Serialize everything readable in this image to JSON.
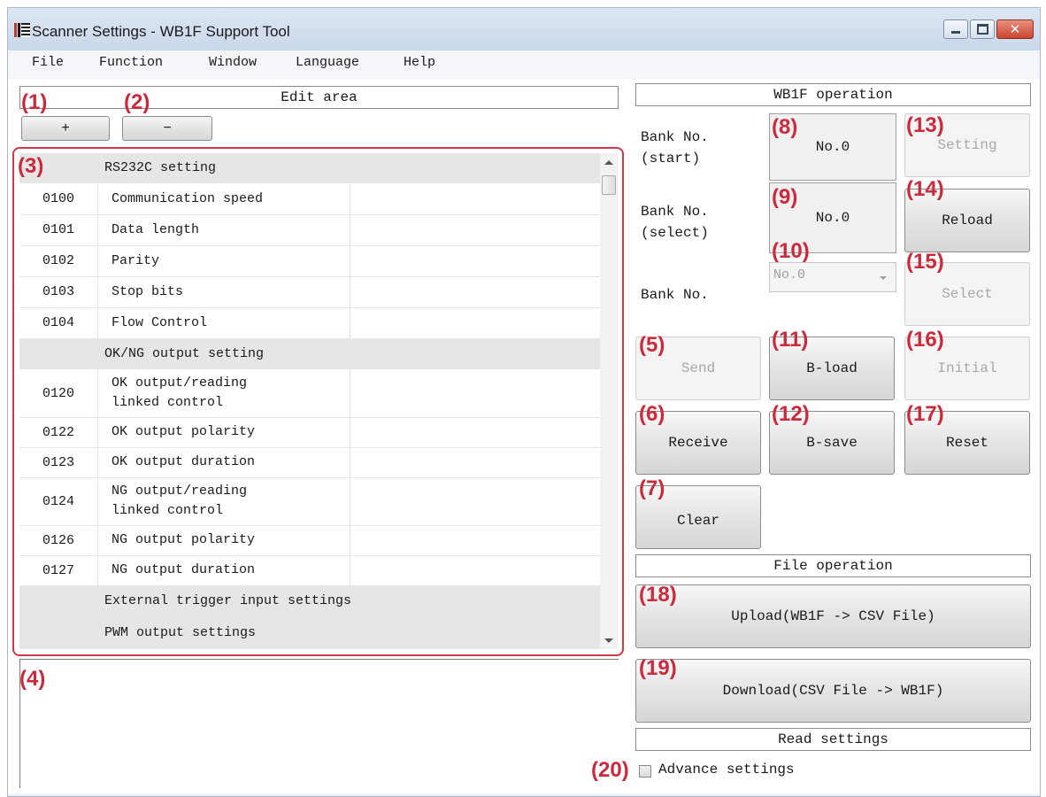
{
  "window": {
    "title": "Scanner Settings - WB1F Support Tool"
  },
  "menu": [
    "File",
    "Function",
    "Window",
    "Language",
    "Help"
  ],
  "edit_area": {
    "header": "Edit area",
    "add_label": "+",
    "remove_label": "−"
  },
  "callouts": {
    "c1": "(1)",
    "c2": "(2)",
    "c3": "(3)",
    "c4": "(4)",
    "c5": "(5)",
    "c6": "(6)",
    "c7": "(7)",
    "c8": "(8)",
    "c9": "(9)",
    "c10": "(10)",
    "c11": "(11)",
    "c12": "(12)",
    "c13": "(13)",
    "c14": "(14)",
    "c15": "(15)",
    "c16": "(16)",
    "c17": "(17)",
    "c18": "(18)",
    "c19": "(19)",
    "c20": "(20)"
  },
  "settings_table": [
    {
      "code": "",
      "name": "RS232C setting",
      "group": true
    },
    {
      "code": "0100",
      "name": "Communication speed"
    },
    {
      "code": "0101",
      "name": "Data length"
    },
    {
      "code": "0102",
      "name": "Parity"
    },
    {
      "code": "0103",
      "name": "Stop bits"
    },
    {
      "code": "0104",
      "name": "Flow Control"
    },
    {
      "code": "",
      "name": "OK/NG output setting",
      "group": true
    },
    {
      "code": "0120",
      "name": "OK output/reading\nlinked control"
    },
    {
      "code": "0122",
      "name": "OK output polarity"
    },
    {
      "code": "0123",
      "name": "OK output duration"
    },
    {
      "code": "0124",
      "name": "NG output/reading\nlinked control"
    },
    {
      "code": "0126",
      "name": "NG output polarity"
    },
    {
      "code": "0127",
      "name": "NG output duration"
    },
    {
      "code": "",
      "name": "External trigger input settings",
      "group": true
    },
    {
      "code": "",
      "name": "PWM output settings",
      "group": true
    }
  ],
  "operation": {
    "header": "WB1F operation",
    "bank_start_label": "Bank No.\n(start)",
    "bank_start_value": "No.0",
    "bank_select_label": "Bank No.\n(select)",
    "bank_select_value": "No.0",
    "bank_label": "Bank No.",
    "bank_dropdown_value": "No.0",
    "setting": "Setting",
    "reload": "Reload",
    "select": "Select",
    "send": "Send",
    "b_load": "B-load",
    "initial": "Initial",
    "receive": "Receive",
    "b_save": "B-save",
    "reset": "Reset",
    "clear": "Clear"
  },
  "file_operation": {
    "header": "File operation",
    "upload": "Upload(WB1F -> CSV File)",
    "download": "Download(CSV File -> WB1F)"
  },
  "read_settings": {
    "header": "Read settings",
    "advance_label": "Advance settings",
    "advance_checked": false
  },
  "colors": {
    "callout": "#cc2a3c",
    "title_bar": "#d3dfee",
    "close_button": "#d8503f"
  }
}
